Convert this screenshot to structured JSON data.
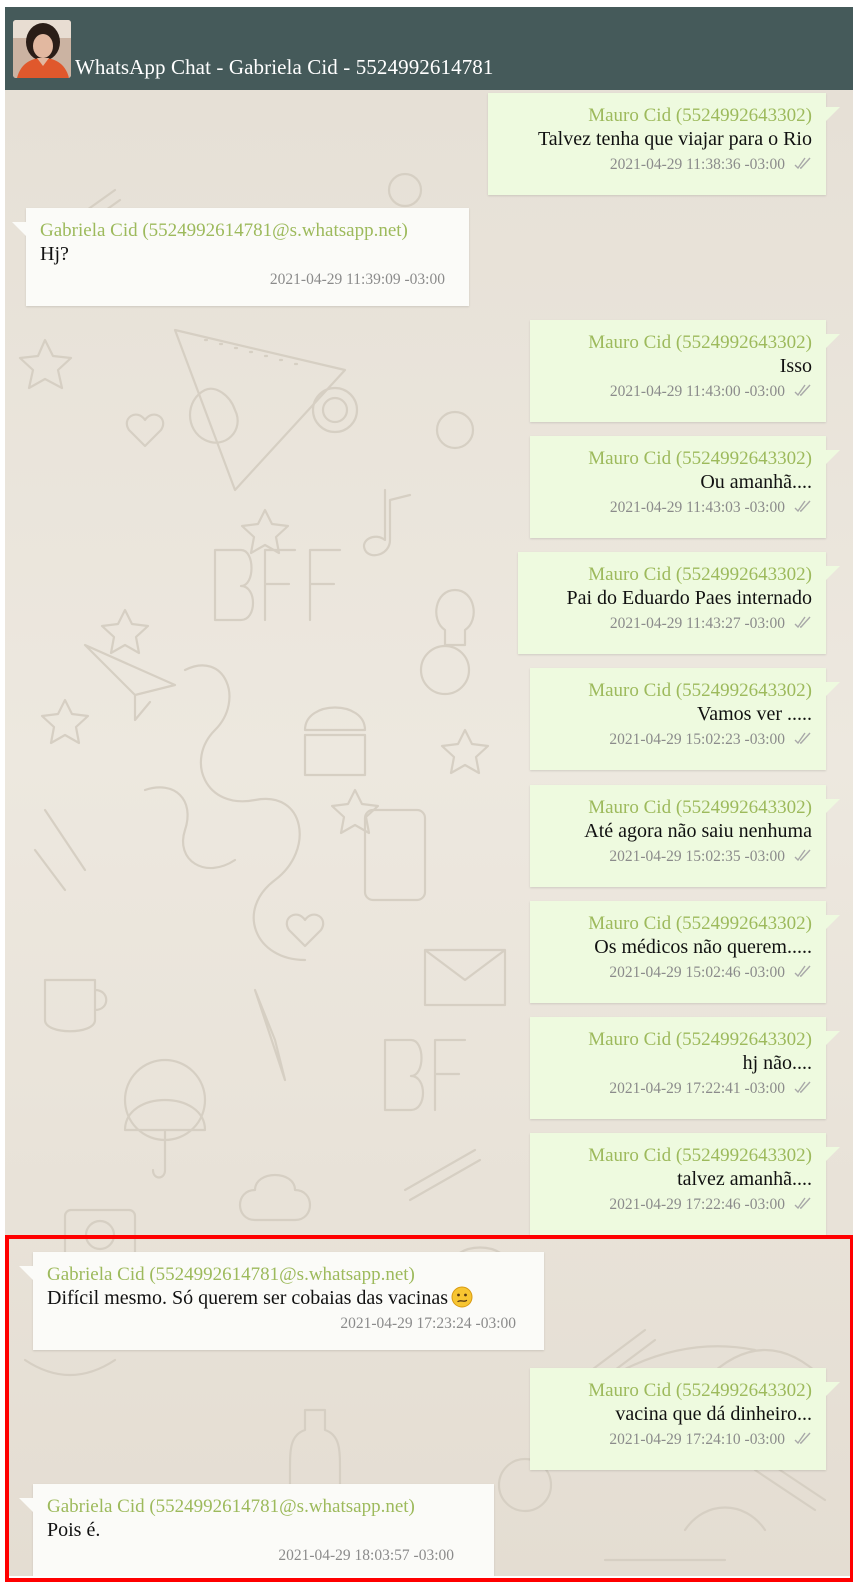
{
  "header": {
    "title": "WhatsApp Chat - Gabriela Cid - 5524992614781"
  },
  "colors": {
    "header_bg": "#455a5a",
    "outgoing_bubble": "#eefadf",
    "incoming_bubble": "#fbfbf8",
    "sender_name": "#9dba5c",
    "timestamp": "#8b8b8b",
    "highlight_border": "#ff0000"
  },
  "messages": [
    {
      "direction": "outgoing",
      "sender": "Mauro Cid (5524992643302)",
      "text": "Talvez tenha que viajar para o Rio",
      "time": "2021-04-29 11:38:36 -03:00",
      "status_icon": "double-check-icon"
    },
    {
      "direction": "incoming",
      "sender": "Gabriela Cid (5524992614781@s.whatsapp.net)",
      "text": "Hj?",
      "time": "2021-04-29 11:39:09 -03:00"
    },
    {
      "direction": "outgoing",
      "sender": "Mauro Cid (5524992643302)",
      "text": "Isso",
      "time": "2021-04-29 11:43:00 -03:00",
      "status_icon": "double-check-icon"
    },
    {
      "direction": "outgoing",
      "sender": "Mauro Cid (5524992643302)",
      "text": "Ou amanhã....",
      "time": "2021-04-29 11:43:03 -03:00",
      "status_icon": "double-check-icon"
    },
    {
      "direction": "outgoing",
      "sender": "Mauro Cid (5524992643302)",
      "text": "Pai do Eduardo Paes internado",
      "time": "2021-04-29 11:43:27 -03:00",
      "status_icon": "double-check-icon"
    },
    {
      "direction": "outgoing",
      "sender": "Mauro Cid (5524992643302)",
      "text": "Vamos ver .....",
      "time": "2021-04-29 15:02:23 -03:00",
      "status_icon": "double-check-icon"
    },
    {
      "direction": "outgoing",
      "sender": "Mauro Cid (5524992643302)",
      "text": "Até agora não saiu nenhuma",
      "time": "2021-04-29 15:02:35 -03:00",
      "status_icon": "double-check-icon"
    },
    {
      "direction": "outgoing",
      "sender": "Mauro Cid (5524992643302)",
      "text": "Os médicos não querem.....",
      "time": "2021-04-29 15:02:46 -03:00",
      "status_icon": "double-check-icon"
    },
    {
      "direction": "outgoing",
      "sender": "Mauro Cid (5524992643302)",
      "text": "hj não....",
      "time": "2021-04-29 17:22:41 -03:00",
      "status_icon": "double-check-icon"
    },
    {
      "direction": "outgoing",
      "sender": "Mauro Cid (5524992643302)",
      "text": "talvez amanhã....",
      "time": "2021-04-29 17:22:46 -03:00",
      "status_icon": "double-check-icon"
    },
    {
      "direction": "incoming",
      "sender": "Gabriela Cid (5524992614781@s.whatsapp.net)",
      "text": "Difícil mesmo. Só querem ser cobaias das vacinas",
      "emoji": "confused-face-emoji",
      "time": "2021-04-29 17:23:24 -03:00"
    },
    {
      "direction": "outgoing",
      "sender": "Mauro Cid (5524992643302)",
      "text": "vacina que dá dinheiro...",
      "time": "2021-04-29 17:24:10 -03:00",
      "status_icon": "double-check-icon"
    },
    {
      "direction": "incoming",
      "sender": "Gabriela Cid (5524992614781@s.whatsapp.net)",
      "text": "Pois é.",
      "time": "2021-04-29 18:03:57 -03:00"
    }
  ]
}
